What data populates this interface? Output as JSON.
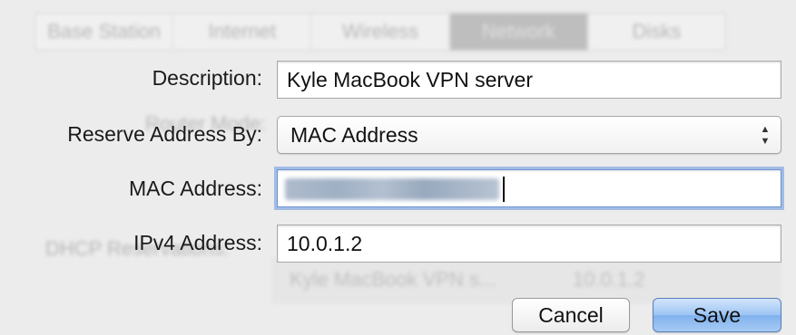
{
  "background": {
    "tabs": [
      "Base Station",
      "Internet",
      "Wireless",
      "Network",
      "Disks"
    ],
    "selected_tab": 3,
    "router_mode_label": "Router Mode:",
    "dhcp_reservations_label": "DHCP Reservations:",
    "reservation_row": {
      "description": "Kyle MacBook VPN s...",
      "address": "10.0.1.2"
    }
  },
  "form": {
    "description": {
      "label": "Description:",
      "value": "Kyle MacBook VPN server"
    },
    "reserve_by": {
      "label": "Reserve Address By:",
      "selected": "MAC Address"
    },
    "mac_address": {
      "label": "MAC Address:",
      "value": ""
    },
    "ipv4_address": {
      "label": "IPv4 Address:",
      "value": "10.0.1.2"
    }
  },
  "buttons": {
    "cancel": "Cancel",
    "save": "Save"
  },
  "colors": {
    "focus_ring": "#6c96d4",
    "default_button": "#9cc4f3",
    "window_bg": "#ececec"
  }
}
